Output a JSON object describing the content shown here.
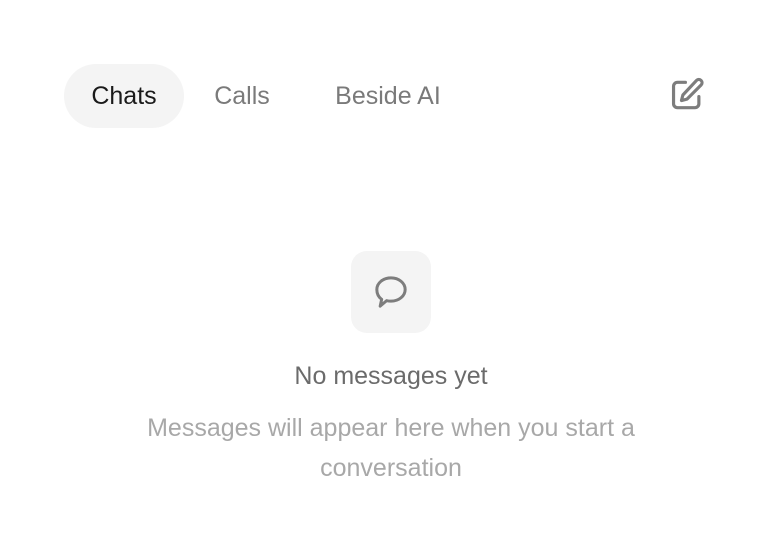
{
  "tabs": [
    {
      "label": "Chats",
      "active": true
    },
    {
      "label": "Calls",
      "active": false
    },
    {
      "label": "Beside AI",
      "active": false
    }
  ],
  "compose": {
    "icon": "compose-edit-icon"
  },
  "empty_state": {
    "icon": "chat-bubble-icon",
    "title": "No messages yet",
    "subtitle": "Messages will appear here when you start a conversation"
  },
  "colors": {
    "active_tab_bg": "#f4f4f4",
    "active_tab_text": "#1a1a1a",
    "inactive_tab_text": "#7a7a7a",
    "title_text": "#6b6b6b",
    "subtitle_text": "#a8a8a8",
    "icon_gray": "#7d7d7d"
  }
}
